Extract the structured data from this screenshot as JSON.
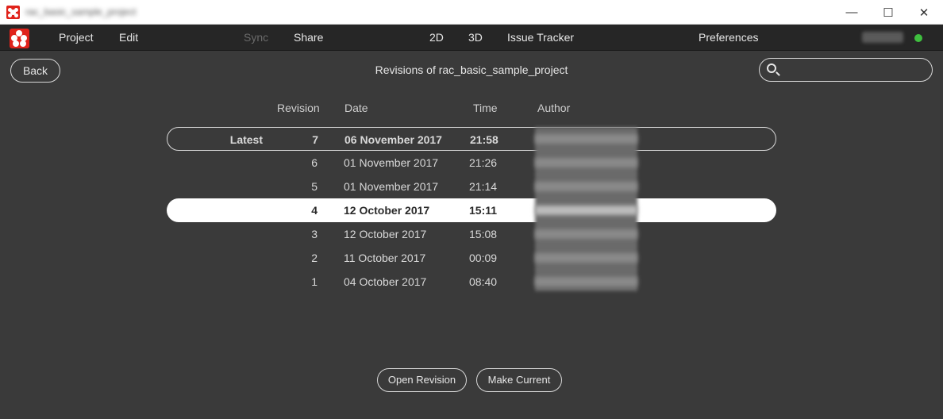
{
  "window": {
    "title": "rac_basic_sample_project"
  },
  "menu": {
    "project": "Project",
    "edit": "Edit",
    "sync": "Sync",
    "share": "Share",
    "view2d": "2D",
    "view3d": "3D",
    "issue_tracker": "Issue Tracker",
    "preferences": "Preferences"
  },
  "colors": {
    "accent": "#e0231b",
    "status_online": "#3fbf3f",
    "background": "#3a3a3a"
  },
  "header": {
    "back_label": "Back",
    "title": "Revisions of rac_basic_sample_project",
    "search_placeholder": ""
  },
  "table": {
    "columns": {
      "revision": "Revision",
      "date": "Date",
      "time": "Time",
      "author": "Author"
    },
    "rows": [
      {
        "tag": "Latest",
        "revision": "7",
        "date": "06 November 2017",
        "time": "21:58"
      },
      {
        "tag": "",
        "revision": "6",
        "date": "01 November 2017",
        "time": "21:26"
      },
      {
        "tag": "",
        "revision": "5",
        "date": "01 November 2017",
        "time": "21:14"
      },
      {
        "tag": "",
        "revision": "4",
        "date": "12 October 2017",
        "time": "15:11"
      },
      {
        "tag": "",
        "revision": "3",
        "date": "12 October 2017",
        "time": "15:08"
      },
      {
        "tag": "",
        "revision": "2",
        "date": "11 October 2017",
        "time": "00:09"
      },
      {
        "tag": "",
        "revision": "1",
        "date": "04 October 2017",
        "time": "08:40"
      }
    ]
  },
  "footer": {
    "open_revision": "Open Revision",
    "make_current": "Make Current"
  }
}
